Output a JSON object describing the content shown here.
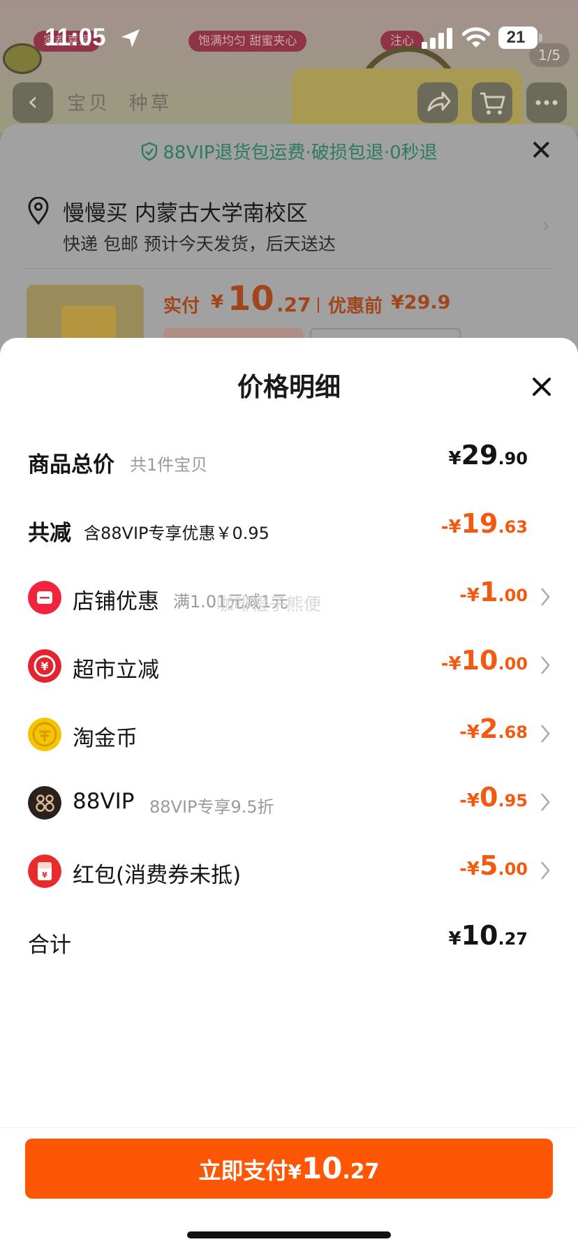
{
  "status_bar": {
    "time": "11:05",
    "battery": "21"
  },
  "product_page": {
    "banner_pills": [
      "家都喜爱",
      "饱满均匀 甜蜜夹心",
      "注心"
    ],
    "image_counter": "1/5",
    "nav_tabs": [
      "宝贝",
      "种草"
    ],
    "icons": [
      "back-icon",
      "share-icon",
      "cart-icon",
      "more-icon"
    ]
  },
  "shipping_sheet": {
    "vip_notice": "88VIP退货包运费·破损包退·0秒退",
    "address": "慢慢买 内蒙古大学南校区",
    "delivery": "快递 包邮 预计今天发货，后天送达",
    "actual_label": "实付",
    "currency": "¥",
    "actual_int": "10",
    "actual_dec": ".27",
    "before_label": "优惠前",
    "before_value": "¥29.9"
  },
  "price_detail": {
    "title": "价格明细",
    "rows": [
      {
        "label": "商品总价",
        "sub": "共1件宝贝",
        "sym": "¥",
        "int": "29",
        "dec": ".90",
        "color": "#141414"
      },
      {
        "label": "共减",
        "sub": "含88VIP专享优惠￥0.95",
        "sym": "-¥",
        "int": "19",
        "dec": ".63",
        "color": "#f25a12"
      },
      {
        "label": "店铺优惠",
        "sub": "满1.01元减1元",
        "sym": "-¥",
        "int": "1",
        "dec": ".00",
        "icon": "shop-discount-icon",
        "color": "#f25a12"
      },
      {
        "label": "超市立减",
        "sub": "",
        "sym": "-¥",
        "int": "10",
        "dec": ".00",
        "icon": "supermarket-discount-icon",
        "color": "#f25a12"
      },
      {
        "label": "淘金币",
        "sub": "",
        "sym": "-¥",
        "int": "2",
        "dec": ".68",
        "icon": "gold-coin-icon",
        "color": "#f25a12"
      },
      {
        "label": "88VIP",
        "sub": "88VIP专享9.5折",
        "sym": "-¥",
        "int": "0",
        "dec": ".95",
        "icon": "vip88-icon",
        "color": "#f25a12"
      },
      {
        "label": "红包(消费券未抵)",
        "sub": "",
        "sym": "-¥",
        "int": "5",
        "dec": ".00",
        "icon": "red-packet-icon",
        "color": "#f25a12"
      },
      {
        "label": "合计",
        "sub": "",
        "sym": "¥",
        "int": "10",
        "dec": ".27",
        "color": "#141414"
      }
    ],
    "watermark": "咖啡橙子熊便"
  },
  "pay_button": {
    "label": "立即支付",
    "sym": "¥",
    "int": "10",
    "dec": ".27",
    "color": "#fd5705"
  }
}
